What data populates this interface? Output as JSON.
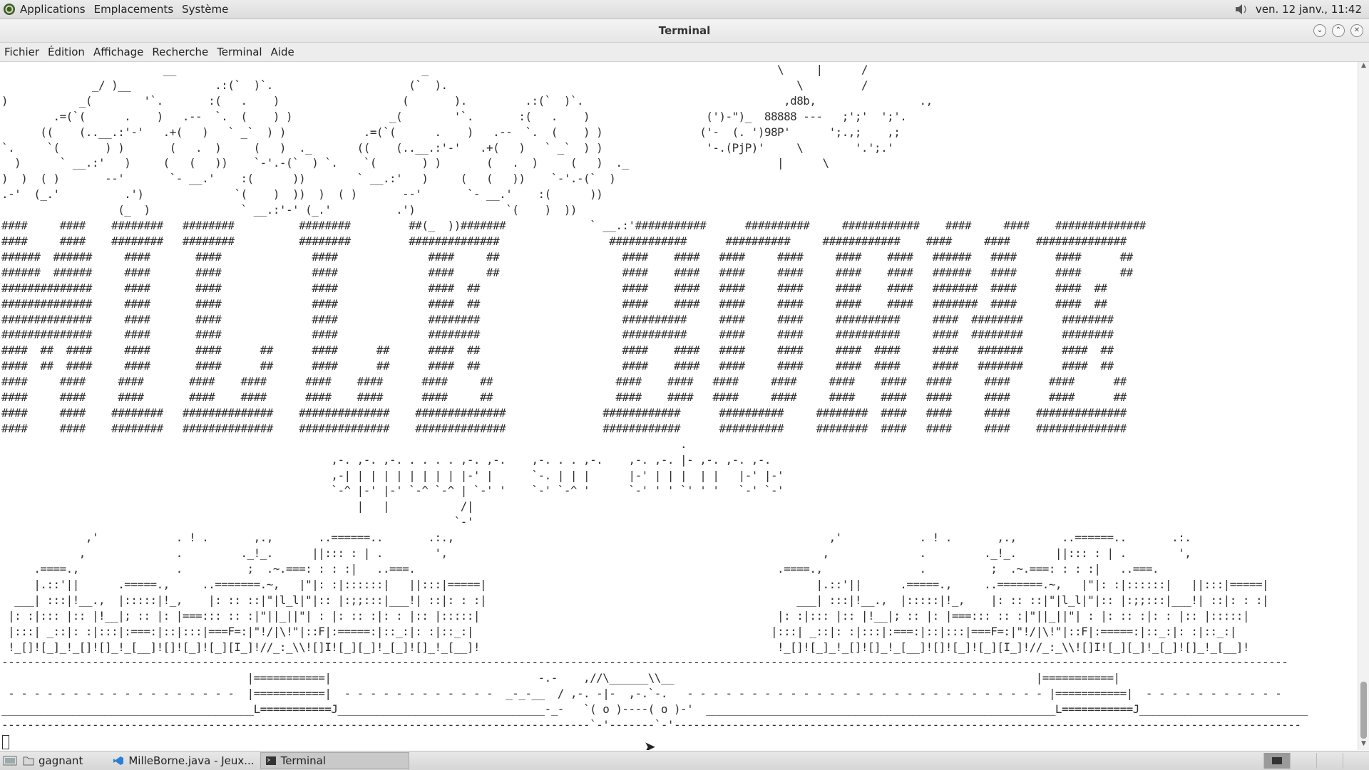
{
  "top_panel": {
    "menus": [
      "Applications",
      "Emplacements",
      "Système"
    ],
    "clock": "ven. 12 janv., 11:42"
  },
  "window": {
    "title": "Terminal"
  },
  "menubar": {
    "items": [
      "Fichier",
      "Édition",
      "Affichage",
      "Recherche",
      "Terminal",
      "Aide"
    ]
  },
  "terminal": {
    "content": "                         __                                      _                                                      \\     |      /\n              _/ )__             .:(`  )`.                     (`  ).                                                      \\         /\n)           _(        '`.       :(   .    )                   (       ).         .:(`  )`.                               ,d8b,                .,\n        .=(`(      .    )   .--  `.  (    ) )               _(        '`.       :(   .    )                  (')-\")_  88888 ---   ;';'  ';'.\n      ((    (..__.:'-'   .+(   )   ` _`  ) )            .=(`(      .    )   .--  `.  (    ) )               ('-  (. ')98P'      ';.,;    ,;\n`.     `(       ) )       (   .  )     (   )  ._       ((    (..__.:'-'   .+(   )   ` _`  ) )                '-.(PjP)'     \\        '.';.'\n  )      ` __.:'   )     (   (   ))    `-'.-(`  ) `.    `(       ) )       (   .  )     (   )  ._                       |      \\\n)  )  ( )       --'       `- __.'    :(      ))        ` __.:'   )     (   (   ))    `-'.-(`  )\n.-'  (_.'          .')              `(    )  ))  )  ( )       --'       `- __.'    :(      ))\n                  (_  )              ` __.:'-' (_.'          .')              `(    )  ))\n####     ####    ########   ########          ########         ##(_  ))#######             ` __.:'###########      ##########     ############    ####     ####    ##############\n####     ####    ########   ########          ########         ##############                 ############      ##########     ############    ####     ####    ##############\n######  ######     ####       ####              ####              ####     ##                   ####    ####   ####     ####     ####    ####   ######   ####      ####      ##\n######  ######     ####       ####              ####              ####     ##                   ####    ####   ####     ####     ####    ####   ######   ####      ####      ##\n##############     ####       ####              ####              ####  ##                      ####    ####   ####     ####     ####    ####   #######  ####      ####  ##\n##############     ####       ####              ####              ####  ##                      ####    ####   ####     ####     ####    ####   #######  ####      ####  ##\n##############     ####       ####              ####              ########                      ##########     ####     ####     ##########     ####  ########      ########\n##############     ####       ####              ####              ########                      ##########     ####     ####     ##########     ####  ########      ########\n####  ##  ####     ####       ####      ##      ####      ##      ####  ##                      ####    ####   ####     ####     ####  ####     ####   #######      ####  ##\n####  ##  ####     ####       ####      ##      ####      ##      ####  ##                      ####    ####   ####     ####     ####  ####     ####   #######      ####  ##\n####     ####     ####       ####    ####      ####    ####      ####     ##                   ####    ####   ####     ####     ####    ####   ####     ####      ####      ##\n####     ####     ####       ####    ####      ####    ####      ####     ##                   ####    ####   ####     ####     ####    ####   ####     ####      ####      ##\n####     ####    ########   ##############    ##############    ##############               ############      ##########     ########  ####   ####     ####    ##############\n####     ####    ########   ##############    ##############    ##############               ############      ##########     ########  ####   ####     ####    ##############\n                                                                                                         .\n                                                   ,-. ,-. ,-. . . . . ,-. ,-.    ,-. . . ,-.    ,-. ,-. |- ,-. ,-. ,-.\n                                                   ,-| | | | | | | | | |-' |      `-. | | |      |-' | | |  | |   |-' |-'\n                                                   `-^ |-' |-' `-^ `-^ | `-' '    `-' `-^ '      `-' ' ' `' ' '   `-' `-'\n                                                       |   |           /|\n                                                                      `-'\n             ,'            . ! .       ,.,       ..======..       .:.,                                                          ,'            . ! .       ,.,       ..======..       .:.\n            ,              .         ._!_.      ||::: : | .        ',                                                          ,              .         ._!_.      ||::: : | .        ',\n     .====.,               .          ;  .~.===: : : :|   ..===.                                                        .====.,               .          ;  .~.===: : : :|   ..===.\n     |.::'||      .=====.,     ..=======.~,   |\"|: :|::::::|   ||:::|=====|                                                   |.::'||      .=====.,     ..=======.~,   |\"|: :|::::::|   ||:::|=====|\n  ___| :::|!__.,  |:::::|!_,    |: :: ::|\"|l_l|\"|:: |:;;:::|___!| ::|: : :|                                                ___| :::|!__.,  |:::::|!_,    |: :: ::|\"|l_l|\"|:: |:;;:::|___!| ::|: : :|\n |: :|::: |:: |!__|; :: |: |===::: :: :|\"||_||\"| : |: :: :|: : |:: |:::::|                                              |: :|::: |:: |!__|; :: |: |===::: :: :|\"||_||\"| : |: :: :|: : |:: |:::::|\n |:::| _::|: :|:::|:===:|::|:::|===F=:|\"!/|\\!\"|::F|:=====:|::_:|: :|::_:|                                              |:::| _::|: :|:::|:===:|::|:::|===F=:|\"!/|\\!\"|::F|:=====:|::_:|: :|::_:|\n !_[]![_]_!_[]![]_!_[__]![]![_]![_][I_]!//_:_\\\\![]I![_][_]!_[_]![]_!_[__]!                                              !_[]![_]_!_[]![]_!_[__]![]![_]![_][I_]!//_:_\\\\![]I![_][_]!_[_]![]_!_[__]!\n-------------------------------------------------------------------------------------------------------------------------------------------------------------------------------------------------------\n                                      |===========|                                -.-    ,//\\______\\\\__                                                        |===========|\n - - - - - - - - - - - - - - - - - -  |===========|  - - - - - - - - - - - -  _-_-__  / ,-. -|-  ,-.`-.   - - - - - - - - - - - - - - - - - - - - - - - - - - - - |===========|  - - - - - - - - - - -\n_______________________________________L===========J________________________________-_-   `( o )----( o )-'  ______________________________________________________L===========J__________________________\n-------------------------------------------------------------------------------------------`-'-------`-'-------------------------------------------------------------------------------------------------"
  },
  "taskbar": {
    "items": [
      "gagnant",
      "MilleBorne.java - Jeux...",
      "Terminal"
    ]
  },
  "colors": {
    "panel_bg": "#e2e2e2",
    "terminal_bg": "#ffffff",
    "terminal_fg": "#2f2f2f"
  }
}
